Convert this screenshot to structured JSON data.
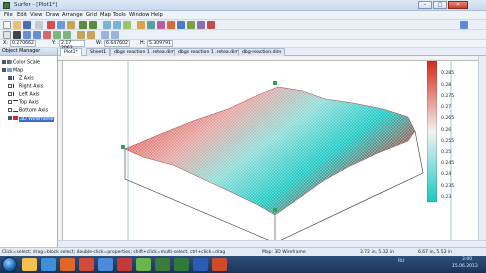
{
  "window": {
    "title": "Surfer - [Plot1*]",
    "min": "–",
    "max": "□",
    "close": "✕"
  },
  "menu": [
    "File",
    "Edit",
    "View",
    "Draw",
    "Arrange",
    "Grid",
    "Map",
    "Tools",
    "Window",
    "Help"
  ],
  "props": {
    "x_label": "X:",
    "x_value": "0.270662",
    "y_label": "Y:",
    "y_value": "2.17 2063",
    "w_label": "W:",
    "w_value": "6.647602",
    "h_label": "H:",
    "h_value": "5.309791"
  },
  "object_manager": {
    "header": "Object Manager",
    "items": [
      {
        "label": "Color Scale"
      },
      {
        "label": "Map"
      },
      {
        "label": "Z Axis"
      },
      {
        "label": "Right Axis"
      },
      {
        "label": "Left Axis"
      },
      {
        "label": "Top Axis"
      },
      {
        "label": "Bottom Axis"
      },
      {
        "label": "3D Wireframe"
      }
    ]
  },
  "tabs": [
    "Plot1*",
    "Sheet1",
    "dbgs reaction 1 .retea.dim",
    "dbgs reaction 1 .retea.dim",
    "dbg-reaction.dim"
  ],
  "legend": {
    "ticks": [
      "0.285",
      "0.28",
      "0.275",
      "0.27",
      "0.265",
      "0.26",
      "0.255",
      "0.25",
      "0.245",
      "0.24",
      "0.235",
      "0.23"
    ],
    "colors": {
      "top": "#d8281c",
      "mid": "#f2f2f2",
      "bottom": "#19c9c4"
    }
  },
  "status": {
    "hint": "Click=select; drag=block select; double-click=properties; shift+click=multi-select; ctrl+click=drag",
    "object": "Map: 3D Wireframe",
    "size": "3.72 in, 5.32 in",
    "pos": "6.67 in, 5.53 in"
  },
  "tray": {
    "lang": "RU",
    "time": "3:00",
    "date": "15.06.2013"
  }
}
